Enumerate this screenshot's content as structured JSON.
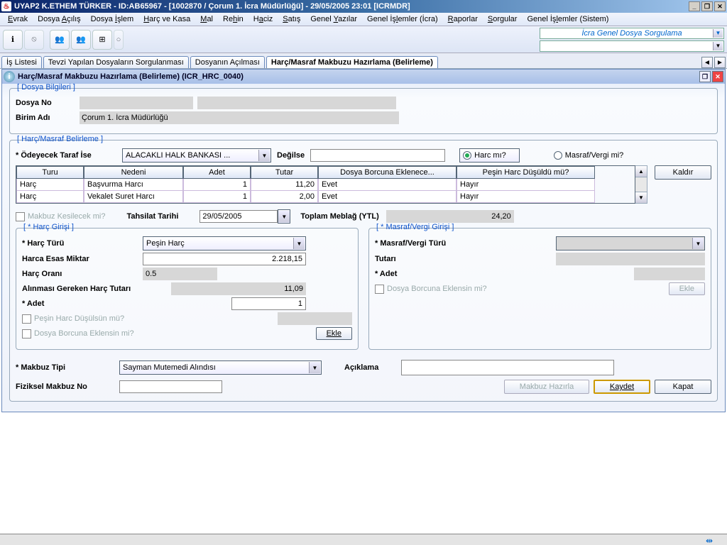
{
  "titlebar": "UYAP2    K.ETHEM TÜRKER - ID:AB65967 - [1002870 / Çorum 1. İcra Müdürlüğü] - 29/05/2005 23:01 [ICRMDR]",
  "menu": [
    "Evrak",
    "Dosya Açılış",
    "Dosya İşlem",
    "Harç ve Kasa",
    "Mal",
    "Rehin",
    "Haciz",
    "Satış",
    "Genel Yazılar",
    "Genel İşlemler (İcra)",
    "Raporlar",
    "Sorgular",
    "Genel İşlemler (Sistem)"
  ],
  "menu_u": [
    0,
    6,
    6,
    0,
    0,
    2,
    1,
    0,
    6,
    8,
    0,
    0,
    8
  ],
  "top_sel": "İcra Genel Dosya Sorgulama",
  "tabs": [
    "İş Listesi",
    "Tevzi Yapılan Dosyaların Sorgulanması",
    "Dosyanın Açılması",
    "Harç/Masraf Makbuzu Hazırlama (Belirleme)"
  ],
  "tab_active": 3,
  "sub_title": "Harç/Masraf Makbuzu Hazırlama (Belirleme) (ICR_HRC_0040)",
  "g_dosya": {
    "legend": "[ Dosya Bilgileri ]",
    "dosya_no_lbl": "Dosya No",
    "dosya_no_val1": "",
    "dosya_no_val2": "",
    "birim_lbl": "Birim Adı",
    "birim_val": "Çorum 1. İcra Müdürlüğü"
  },
  "g_belirleme": {
    "legend": "[ Harç/Masraf Belirleme ]",
    "odeyecek_lbl": "* Ödeyecek Taraf İse",
    "odeyecek_val": "ALACAKLI HALK BANKASI ...",
    "degilse_lbl": "Değilse",
    "degilse_val": "",
    "r_harc": "Harc mı?",
    "r_masraf": "Masraf/Vergi mi?",
    "headers": [
      "Turu",
      "Nedeni",
      "Adet",
      "Tutar",
      "Dosya Borcuna Eklenece...",
      "Peşin Harc Düşüldü mü?"
    ],
    "rows": [
      [
        "Harç",
        "Başvurma Harcı",
        "1",
        "11,20",
        "Evet",
        "Hayır"
      ],
      [
        "Harç",
        "Vekalet Suret Harcı",
        "1",
        "2,00",
        "Evet",
        "Hayır"
      ]
    ],
    "kaldir": "Kaldır",
    "makbuz_chk": "Makbuz Kesilecek mi?",
    "tahsilat_lbl": "Tahsilat Tarihi",
    "tahsilat_val": "29/05/2005",
    "toplam_lbl": "Toplam Meblağ (YTL)",
    "toplam_val": "24,20"
  },
  "g_harc": {
    "legend": "[ * Harç Girişi ]",
    "turu_lbl": "* Harç Türü",
    "turu_val": "Peşin Harç",
    "esas_lbl": "Harca Esas Miktar",
    "esas_val": "2.218,15",
    "oran_lbl": "Harç Oranı",
    "oran_val": "0.5",
    "gereken_lbl": "Alınması Gereken Harç Tutarı",
    "gereken_val": "11,09",
    "adet_lbl": "* Adet",
    "adet_val": "1",
    "pesin_chk": "Peşin Harc Düşülsün mü?",
    "borc_chk": "Dosya Borcuna Eklensin mi?",
    "ekle": "Ekle"
  },
  "g_masraf": {
    "legend": "[ * Masraf/Vergi Girişi ]",
    "turu_lbl": "* Masraf/Vergi Türü",
    "tutar_lbl": "Tutarı",
    "adet_lbl": "* Adet",
    "borc_chk": "Dosya Borcuna Eklensin mi?",
    "ekle": "Ekle"
  },
  "footer": {
    "makbuz_tipi_lbl": "* Makbuz Tipi",
    "makbuz_tipi_val": "Sayman Mutemedi Alındısı",
    "fiziksel_lbl": "Fiziksel Makbuz No",
    "aciklama_lbl": "Açıklama",
    "hazirla": "Makbuz Hazırla",
    "kaydet": "Kaydet",
    "kapat": "Kapat"
  }
}
